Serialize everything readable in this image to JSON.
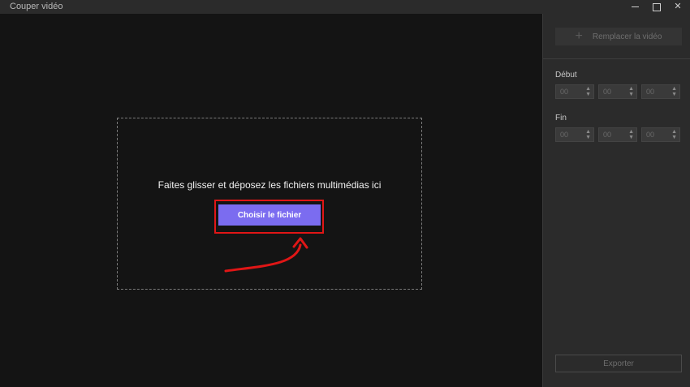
{
  "window": {
    "title": "Couper vidéo"
  },
  "dropzone": {
    "instruction": "Faites glisser et déposez les fichiers multimédias ici",
    "choose_label": "Choisir le fichier"
  },
  "sidebar": {
    "replace_label": "Remplacer la vidéo",
    "start_label": "Début",
    "start_values": [
      "00",
      "00",
      "00"
    ],
    "end_label": "Fin",
    "end_values": [
      "00",
      "00",
      "00"
    ],
    "export_label": "Exporter"
  },
  "colors": {
    "accent": "#7b6cf0",
    "annotation": "#e01616"
  },
  "icons": {
    "add": "plus-icon",
    "spinner": "spinner-icon",
    "annotation_arrow": "curved-arrow-icon"
  }
}
